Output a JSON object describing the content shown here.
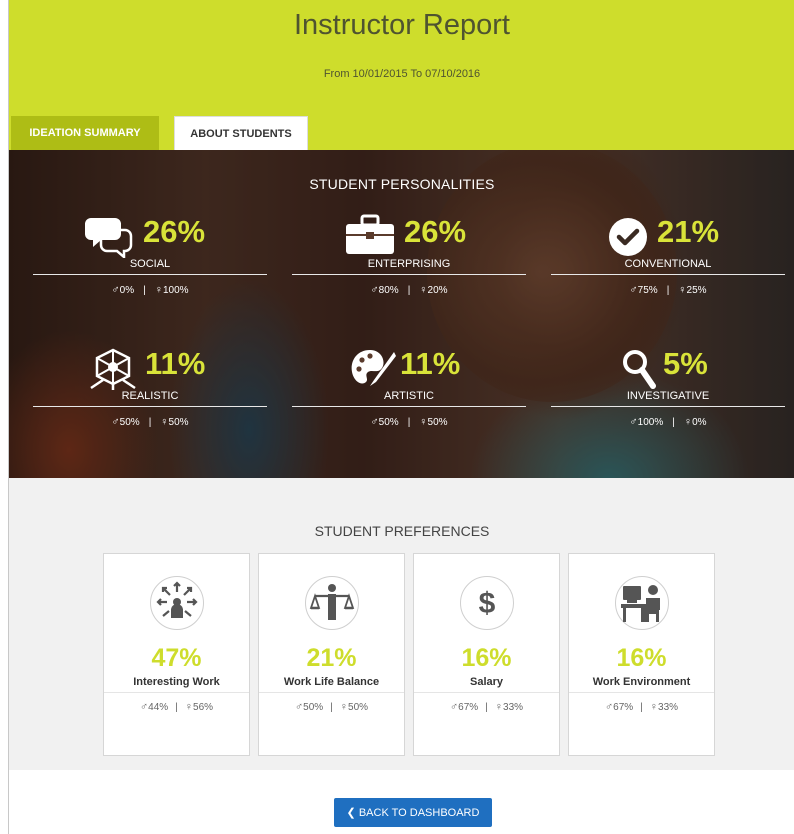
{
  "header": {
    "title": "Instructor Report",
    "date_range": "From 10/01/2015 To 07/10/2016",
    "bg_color": "#cedd2c"
  },
  "tabs": [
    {
      "label": "IDEATION SUMMARY",
      "active": false
    },
    {
      "label": "ABOUT STUDENTS",
      "active": true
    }
  ],
  "personalities": {
    "heading": "STUDENT PERSONALITIES",
    "items": [
      {
        "icon": "speech-bubbles-icon",
        "percent": "26%",
        "label": "SOCIAL",
        "male": "0%",
        "female": "100%"
      },
      {
        "icon": "briefcase-icon",
        "percent": "26%",
        "label": "ENTERPRISING",
        "male": "80%",
        "female": "20%"
      },
      {
        "icon": "check-circle-icon",
        "percent": "21%",
        "label": "CONVENTIONAL",
        "male": "75%",
        "female": "25%"
      },
      {
        "icon": "cube-structure-icon",
        "percent": "11%",
        "label": "REALISTIC",
        "male": "50%",
        "female": "50%"
      },
      {
        "icon": "palette-icon",
        "percent": "11%",
        "label": "ARTISTIC",
        "male": "50%",
        "female": "50%"
      },
      {
        "icon": "magnifier-icon",
        "percent": "5%",
        "label": "INVESTIGATIVE",
        "male": "100%",
        "female": "0%"
      }
    ]
  },
  "preferences": {
    "heading": "STUDENT PREFERENCES",
    "items": [
      {
        "icon": "directions-person-icon",
        "percent": "47%",
        "label": "Interesting Work",
        "male": "44%",
        "female": "56%"
      },
      {
        "icon": "balance-scale-person-icon",
        "percent": "21%",
        "label": "Work Life Balance",
        "male": "50%",
        "female": "50%"
      },
      {
        "icon": "dollar-icon",
        "percent": "16%",
        "label": "Salary",
        "male": "67%",
        "female": "33%"
      },
      {
        "icon": "desk-computer-icon",
        "percent": "16%",
        "label": "Work Environment",
        "male": "67%",
        "female": "33%"
      }
    ]
  },
  "glyphs": {
    "male": "♂",
    "female": "♀",
    "separator": "|"
  },
  "back_button": {
    "label": "❮ BACK TO DASHBOARD",
    "color": "#1f6fc0"
  },
  "accent_color": "#d9e339"
}
